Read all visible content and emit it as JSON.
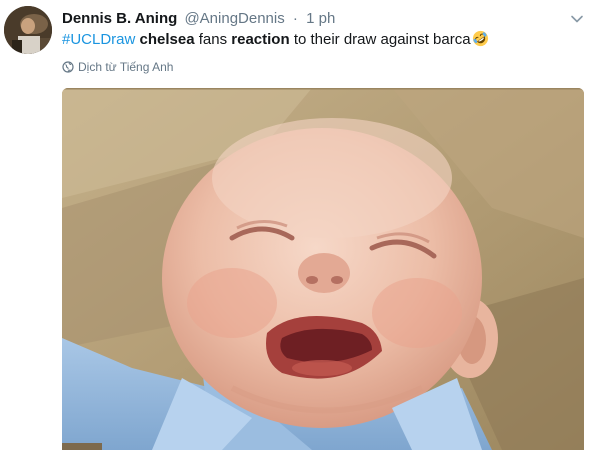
{
  "tweet": {
    "author": {
      "display_name": "Dennis B. Aning",
      "handle": "@AningDennis",
      "separator": "·",
      "time": "1 ph"
    },
    "text": {
      "hashtag": "#UCLDraw",
      "word1": "chelsea",
      "word2": "fans",
      "word3": "reaction",
      "rest": "to their draw against barca"
    },
    "emoji": "rolling-on-floor-laughing-emoji",
    "translate_label": "Dịch từ Tiếng Anh",
    "media": {
      "subject": "crying baby in blue shirt on a couch"
    },
    "colors": {
      "hashtag": "#1b95e0",
      "name": "#14171a",
      "secondary": "#657786"
    }
  }
}
